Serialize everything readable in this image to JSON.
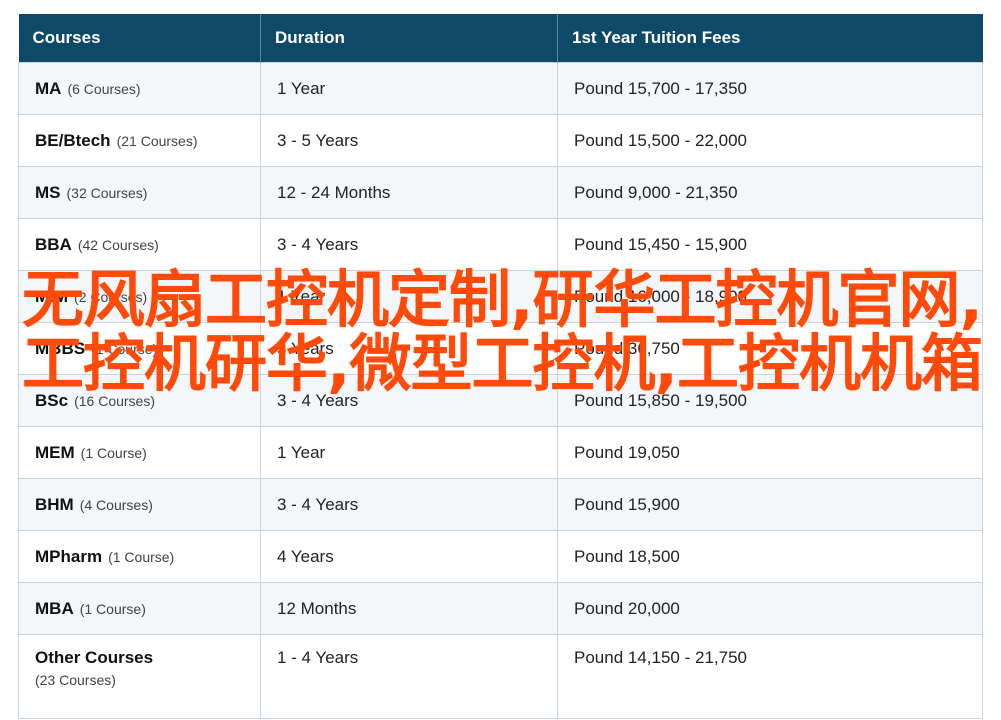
{
  "headers": [
    "Courses",
    "Duration",
    "1st Year Tuition Fees"
  ],
  "rows": [
    {
      "course": "MA",
      "count": "(6 Courses)",
      "duration": "1 Year",
      "fees": "Pound 15,700 - 17,350"
    },
    {
      "course": "BE/Btech",
      "count": "(21 Courses)",
      "duration": "3 - 5 Years",
      "fees": "Pound 15,500 - 22,000"
    },
    {
      "course": "MS",
      "count": "(32 Courses)",
      "duration": "12 - 24 Months",
      "fees": "Pound 9,000 - 21,350"
    },
    {
      "course": "BBA",
      "count": "(42 Courses)",
      "duration": "3 - 4 Years",
      "fees": "Pound 15,450 - 15,900"
    },
    {
      "course": "MIM",
      "count": "(2 Courses)",
      "duration": "1 Year",
      "fees": "Pound 16,000 - 18,900"
    },
    {
      "course": "MBBS",
      "count": "(1 Course)",
      "duration": "5 Years",
      "fees": "Pound 36,750"
    },
    {
      "course": "BSc",
      "count": "(16 Courses)",
      "duration": "3 - 4 Years",
      "fees": "Pound 15,850 - 19,500"
    },
    {
      "course": "MEM",
      "count": "(1 Course)",
      "duration": "1 Year",
      "fees": "Pound 19,050"
    },
    {
      "course": "BHM",
      "count": "(4 Courses)",
      "duration": "3 - 4 Years",
      "fees": "Pound 15,900"
    },
    {
      "course": "MPharm",
      "count": "(1 Course)",
      "duration": "4 Years",
      "fees": "Pound 18,500"
    },
    {
      "course": "MBA",
      "count": "(1 Course)",
      "duration": "12 Months",
      "fees": "Pound 20,000"
    },
    {
      "course": "Other Courses",
      "count": "(23 Courses)",
      "duration": "1 - 4 Years",
      "fees": "Pound 14,150 - 21,750"
    }
  ],
  "overlay_text": "无风扇工控机定制,研华工控机官网,工控机研华,微型工控机,工控机机箱",
  "colors": {
    "header_bg": "#0e4a68",
    "overlay_text": "#ff4a0a"
  }
}
